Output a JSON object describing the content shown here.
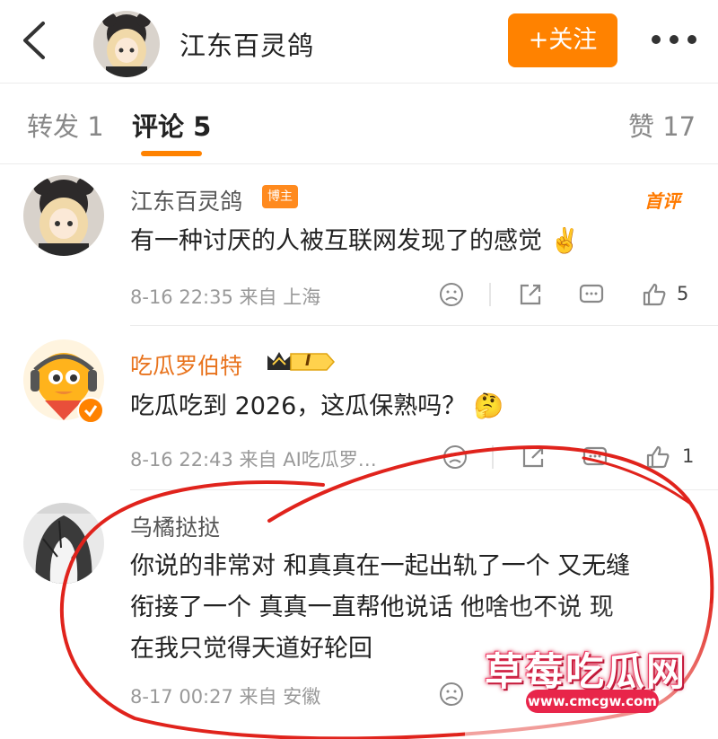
{
  "header": {
    "name": "江东百灵鸽",
    "follow_label": "+关注"
  },
  "tabs": {
    "repost": "转发 1",
    "comment": "评论 5",
    "like": "赞 17"
  },
  "comments": [
    {
      "name": "江东百灵鸽",
      "badge": "博主",
      "tag": "首评",
      "text": "有一种讨厌的人被互联网发现了的感觉",
      "emoji": "✌️",
      "meta": "8-16 22:35 来自 上海",
      "like_count": "5"
    },
    {
      "name": "吃瓜罗伯特",
      "vip_level": "I",
      "text": "吃瓜吃到 2026，这瓜保熟吗？",
      "emoji": "🤔",
      "meta": "8-16 22:43 来自 AI吃瓜罗…",
      "like_count": "1"
    },
    {
      "name": "乌橘挞挞",
      "text_lines": [
        "你说的非常对 和真真在一起出轨了一个 又无缝",
        "衔接了一个 真真一直帮他说话 他啥也不说 现",
        "在我只觉得天道好轮回"
      ],
      "meta": "8-17 00:27 来自 安徽"
    }
  ],
  "watermark": {
    "title": "草莓吃瓜网",
    "url": "www.cmcgw.com"
  },
  "colors": {
    "accent": "#ff8200",
    "vip_name": "#e8731d",
    "annotation": "#e0231c"
  }
}
